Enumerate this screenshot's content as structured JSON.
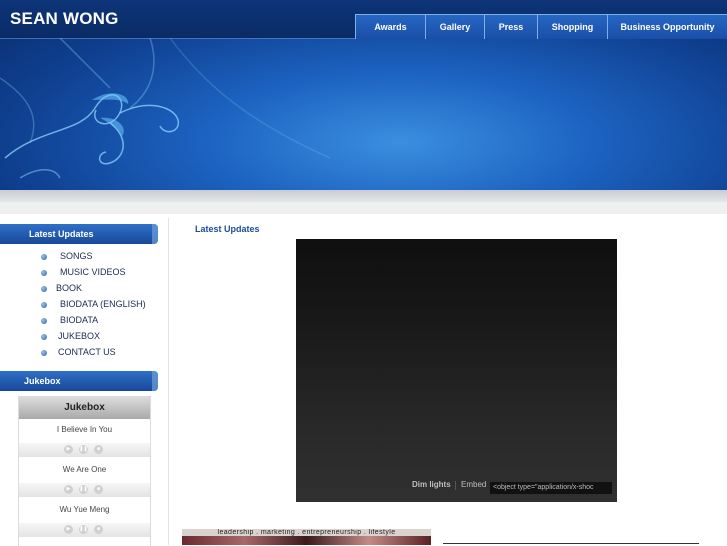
{
  "header": {
    "site_title": "SEAN WONG",
    "nav": [
      "Awards",
      "Gallery",
      "Press",
      "Shopping",
      "Business Opportunity"
    ]
  },
  "sidebar": {
    "latest_updates_heading": "Latest Updates",
    "menu": [
      "SONGS",
      "MUSIC VIDEOS",
      "BOOK",
      "BIODATA (ENGLISH)",
      "BIODATA",
      "JUKEBOX",
      "CONTACT US"
    ],
    "jukebox_heading": "Jukebox"
  },
  "jukebox": {
    "title": "Jukebox",
    "songs": [
      "I Believe In You",
      "We Are One",
      "Wu Yue Meng"
    ],
    "controls": [
      "play-icon",
      "pause-icon",
      "stop-icon"
    ]
  },
  "main": {
    "title": "Latest Updates",
    "video": {
      "dim_lights": "Dim lights",
      "embed": "Embed",
      "embed_code": "<object type=\"application/x-shoc"
    },
    "thumbnail_caption": "leadership . marketing . entrepreneurship . lifestyle"
  },
  "colors": {
    "header_dark": "#0a2c66",
    "accent_blue": "#1e4b9b",
    "nav_blue": "#2667c4"
  }
}
